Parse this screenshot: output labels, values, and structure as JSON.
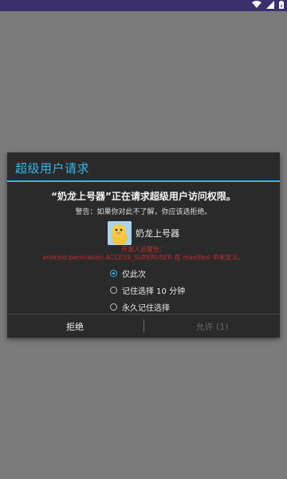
{
  "status_bar": {
    "icons": [
      "wifi-icon",
      "signal-icon",
      "battery-icon"
    ]
  },
  "dialog": {
    "title": "超级用户请求",
    "headline": "“奶龙上号器”正在请求超级用户访问权限。",
    "warning": "警告：如果你对此不了解，你应该选拒绝。",
    "app": {
      "name": "奶龙上号器",
      "icon": "app-icon"
    },
    "dev_warning_line1": "开发人员警告：",
    "dev_warning_line2": "android.permission.ACCESS_SUPERUSER 在 manifest 中未定义。",
    "options": [
      {
        "label": "仅此次",
        "checked": true
      },
      {
        "label": "记住选择 10 分钟",
        "checked": false
      },
      {
        "label": "永久记住选择",
        "checked": false
      }
    ],
    "deny_label": "拒绝",
    "allow_label": "允许 (1)"
  },
  "colors": {
    "accent": "#33b5e5",
    "status_bar": "#3d2e6e",
    "overlay": "#7b7b7b",
    "dialog_bg": "#2a2a2a",
    "dev_warning": "#cc2a2a"
  }
}
